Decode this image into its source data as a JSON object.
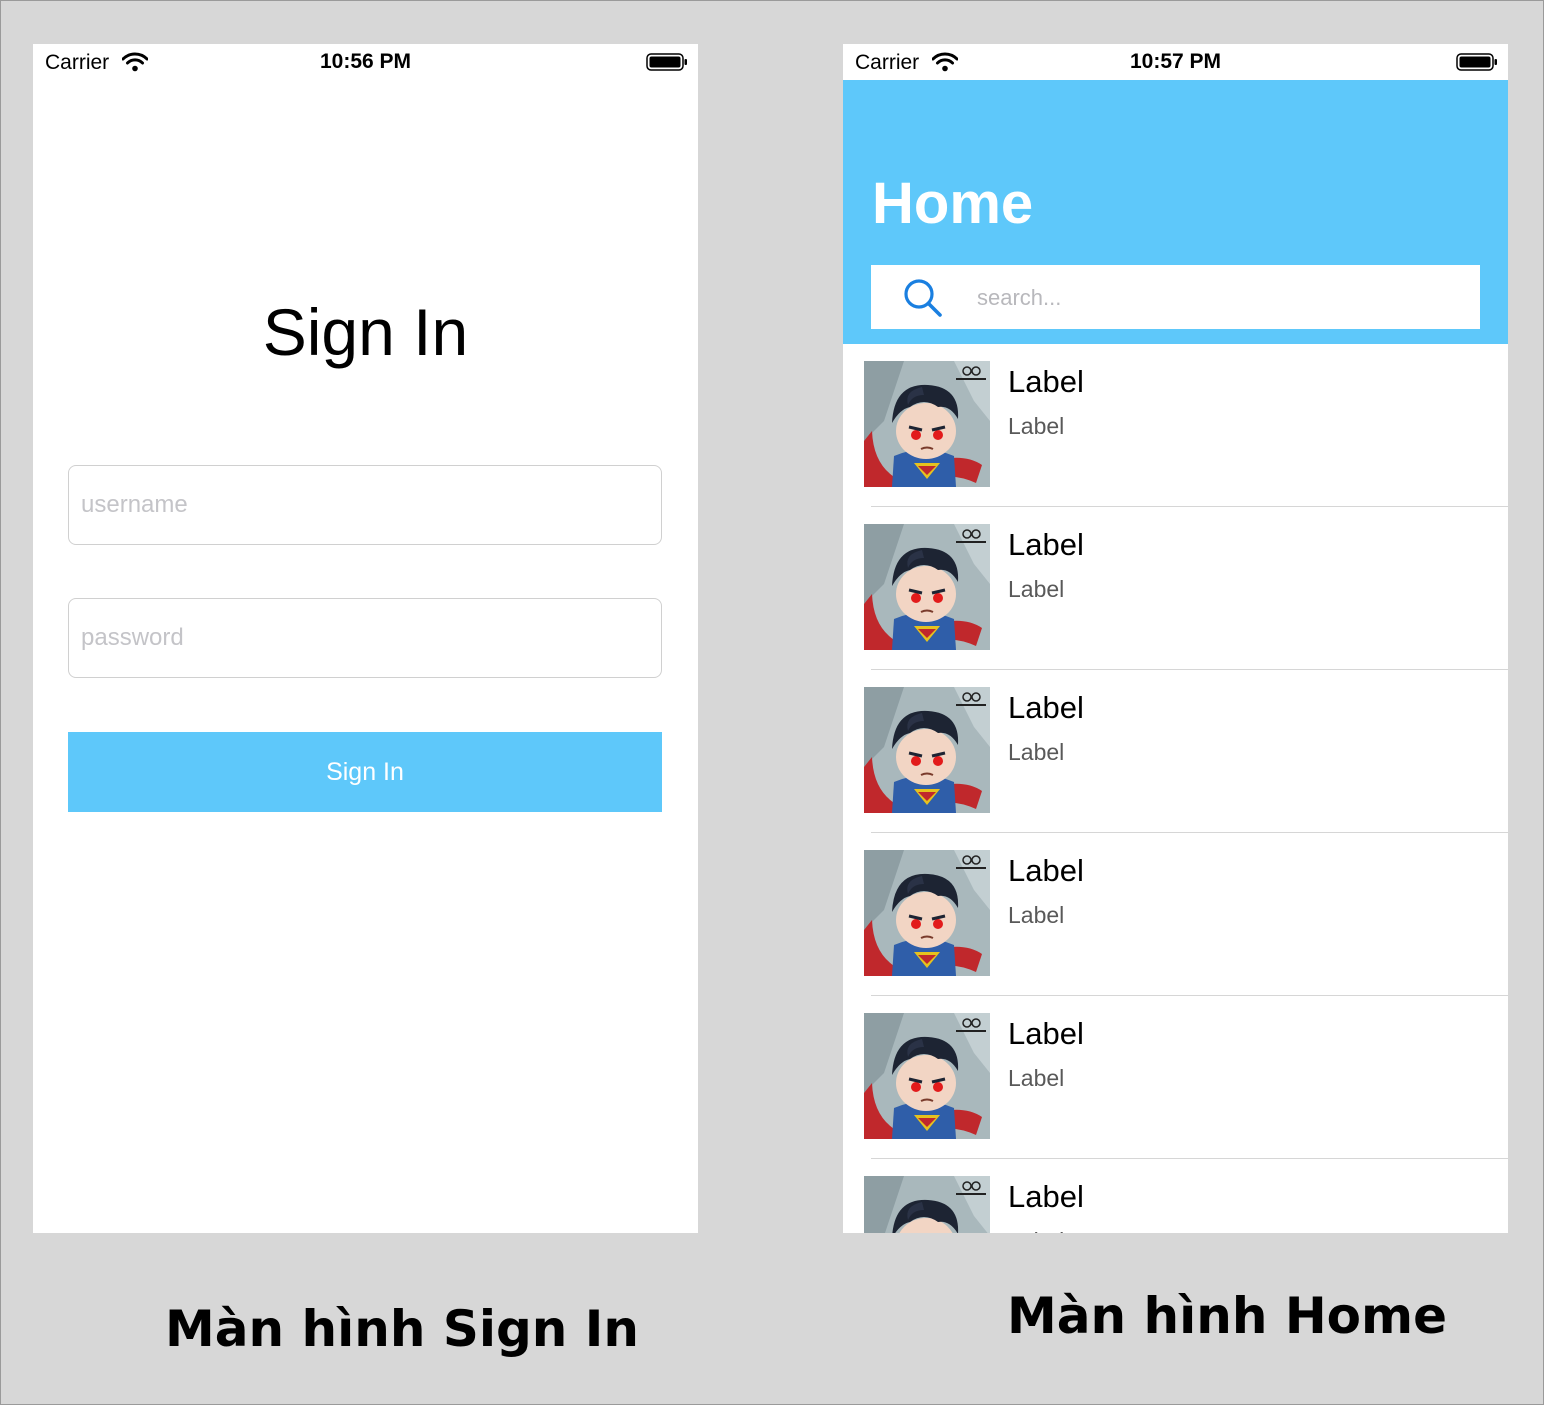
{
  "signin_screen": {
    "status_bar": {
      "carrier": "Carrier",
      "time": "10:56 PM"
    },
    "title": "Sign In",
    "username": {
      "placeholder": "username",
      "value": ""
    },
    "password": {
      "placeholder": "password",
      "value": ""
    },
    "button_label": "Sign In"
  },
  "home_screen": {
    "status_bar": {
      "carrier": "Carrier",
      "time": "10:57 PM"
    },
    "title": "Home",
    "search": {
      "placeholder": "search...",
      "value": ""
    },
    "rows": [
      {
        "title": "Label",
        "subtitle": "Label",
        "image": "superman-thumbnail"
      },
      {
        "title": "Label",
        "subtitle": "Label",
        "image": "superman-thumbnail"
      },
      {
        "title": "Label",
        "subtitle": "Label",
        "image": "superman-thumbnail"
      },
      {
        "title": "Label",
        "subtitle": "Label",
        "image": "superman-thumbnail"
      },
      {
        "title": "Label",
        "subtitle": "Label",
        "image": "superman-thumbnail"
      },
      {
        "title": "Label",
        "subtitle": "Label",
        "image": "superman-thumbnail"
      }
    ]
  },
  "captions": {
    "signin": "Màn hình Sign In",
    "home": "Màn hình Home"
  },
  "colors": {
    "accent": "#5ec8fa",
    "background": "#d7d7d7",
    "search_icon": "#1a7fe0"
  }
}
